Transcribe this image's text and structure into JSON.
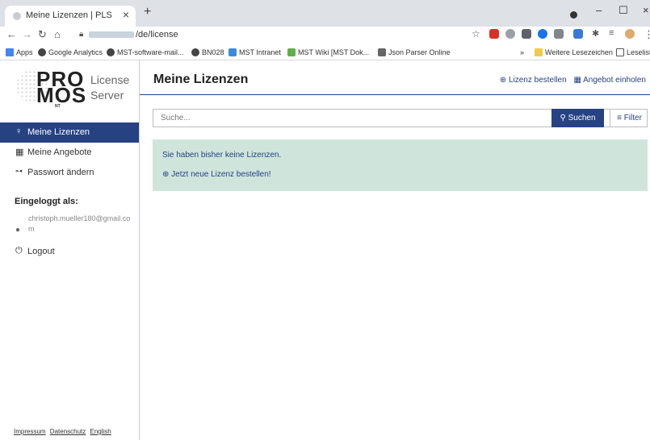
{
  "browser": {
    "tab_title": "Meine Lizenzen | PLS",
    "url_path": "/de/license",
    "bookmarks": [
      "Apps",
      "Google Analytics",
      "MST-software-mail...",
      "BN028",
      "MST Intranet",
      "MST Wiki [MST Dok...",
      "Json Parser Online"
    ],
    "more_bookmarks": "Weitere Lesezeichen",
    "reading_list": "Leseliste"
  },
  "logo": {
    "line1": "PRO",
    "line2": "MOS",
    "nt": "NT",
    "product1": "License",
    "product2": "Server"
  },
  "sidebar": {
    "items": [
      {
        "label": "Meine Lizenzen",
        "icon": "lightbulb-icon",
        "active": true
      },
      {
        "label": "Meine Angebote",
        "icon": "calculator-icon",
        "active": false
      },
      {
        "label": "Passwort ändern",
        "icon": "key-icon",
        "active": false
      }
    ],
    "logged_in_label": "Eingeloggt als:",
    "user_email": "christoph.mueller180@gmail.com",
    "logout_label": "Logout",
    "footer": {
      "impressum": "Impressum",
      "datenschutz": "Datenschutz",
      "english": "English"
    }
  },
  "main": {
    "title": "Meine Lizenzen",
    "order_license": "Lizenz bestellen",
    "request_offer": "Angebot einholen",
    "search": {
      "placeholder": "Suche...",
      "button": "Suchen",
      "filter": "Filter"
    },
    "notice": {
      "text": "Sie haben bisher keine Lizenzen.",
      "link": "Jetzt neue Lizenz bestellen!"
    }
  },
  "colors": {
    "primary": "#264283",
    "notice_bg": "#cfe5dc"
  }
}
